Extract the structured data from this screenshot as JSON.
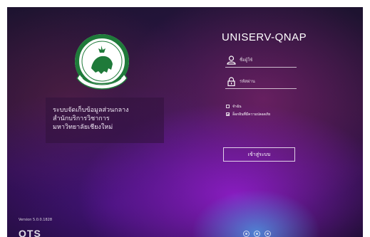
{
  "login": {
    "app_title": "UNISERV-QNAP",
    "username_placeholder": "ชื่อผู้ใช้",
    "password_placeholder": "รหัสผ่าน",
    "remember_label": "จำฉัน",
    "remember_checked": false,
    "secure_label": "ล็อกอินที่มีความปลอดภัย",
    "secure_checked": true,
    "submit_label": "เข้าสู่ระบบ"
  },
  "org": {
    "lines": [
      "ระบบจัดเก็บข้อมูลส่วนกลาง",
      "สำนักบริการวิชาการ",
      "มหาวิทยาลัยเชียงใหม่"
    ]
  },
  "footer": {
    "version": "Version 5.0.0.1828",
    "brand": "QTS",
    "icons": [
      "info-icon",
      "support-icon",
      "language-icon"
    ]
  },
  "colors": {
    "logo_green": "#1f7a3a",
    "text": "#ffffff"
  }
}
